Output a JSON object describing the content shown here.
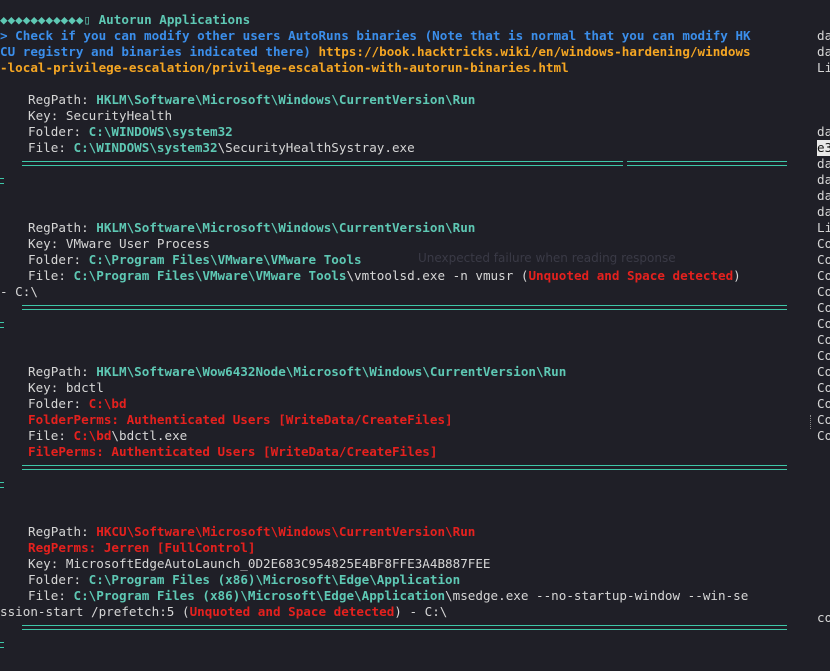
{
  "header": {
    "bullets": "◆◆◆◆◆◆◆◆◆◆◆",
    "box": "▯",
    "title": "Autorun Applications",
    "check_line1": "> Check if you can modify other users AutoRuns binaries (Note that is normal that you can modify HK",
    "check_line2a": "CU registry and binaries indicated there) ",
    "url_part1": "https://book.hacktricks.wiki/en/windows-hardening/windows",
    "url_part2": "-local-privilege-escalation/privilege-escalation-with-autorun-binaries.html"
  },
  "labels": {
    "regpath": "RegPath: ",
    "key": "Key: ",
    "folder": "Folder: ",
    "file": "File: ",
    "folderperms": "FolderPerms: ",
    "fileperms": "FilePerms: ",
    "regperms": "RegPerms: ",
    "unquoted": "Unquoted and Space detected",
    "open_paren": " (",
    "close_tail": ")",
    "tail_c": " - C:\\"
  },
  "entries": [
    {
      "regpath": "HKLM\\Software\\Microsoft\\Windows\\CurrentVersion\\Run",
      "key": "SecurityHealth",
      "folder": "C:\\WINDOWS\\system32",
      "file_dir": "C:\\WINDOWS\\system32",
      "file_rest": "\\SecurityHealthSystray.exe"
    },
    {
      "regpath": "HKLM\\Software\\Microsoft\\Windows\\CurrentVersion\\Run",
      "key": "VMware User Process",
      "folder": "C:\\Program Files\\VMware\\VMware Tools",
      "file_dir": "C:\\Program Files\\VMware\\VMware Tools",
      "file_rest": "\\vmtoolsd.exe -n vmusr",
      "wrap": "- C:\\"
    },
    {
      "regpath": "HKLM\\Software\\Wow6432Node\\Microsoft\\Windows\\CurrentVersion\\Run",
      "key": "bdctl",
      "folder": "C:\\bd",
      "folderperms": "Authenticated Users [WriteData/CreateFiles]",
      "file_dir": "C:\\bd",
      "file_rest": "\\bdctl.exe",
      "fileperms": "Authenticated Users [WriteData/CreateFiles]"
    },
    {
      "regpath": "HKCU\\Software\\Microsoft\\Windows\\CurrentVersion\\Run",
      "regperms": "Jerren [FullControl]",
      "key": "MicrosoftEdgeAutoLaunch_0D2E683C954825E4BF8FFE3A4B887FEE",
      "folder": "C:\\Program Files (x86)\\Microsoft\\Edge\\Application",
      "file_dir": "C:\\Program Files (x86)\\Microsoft\\Edge\\Application",
      "file_rest": "\\msedge.exe --no-startup-window --win-se",
      "wrap_start": "ssion-start /prefetch:5"
    }
  ],
  "ghost": {
    "line1": "Unexpected failure when reading response"
  },
  "side_pane": {
    "rows": [
      "da",
      "da",
      "Li",
      "da",
      "e3",
      "da",
      "da",
      "da",
      "da",
      "Li",
      "Co",
      "Co",
      "Co",
      "Co",
      "Co",
      "Co",
      "Co",
      "Co",
      "Co",
      "Co",
      "Co",
      "Co",
      "Co",
      "co"
    ]
  },
  "colors": {
    "background": "#1f1f27",
    "cyan": "#5ec8b4",
    "blue": "#3b8eea",
    "orange": "#f5a623",
    "red": "#e5211e"
  }
}
